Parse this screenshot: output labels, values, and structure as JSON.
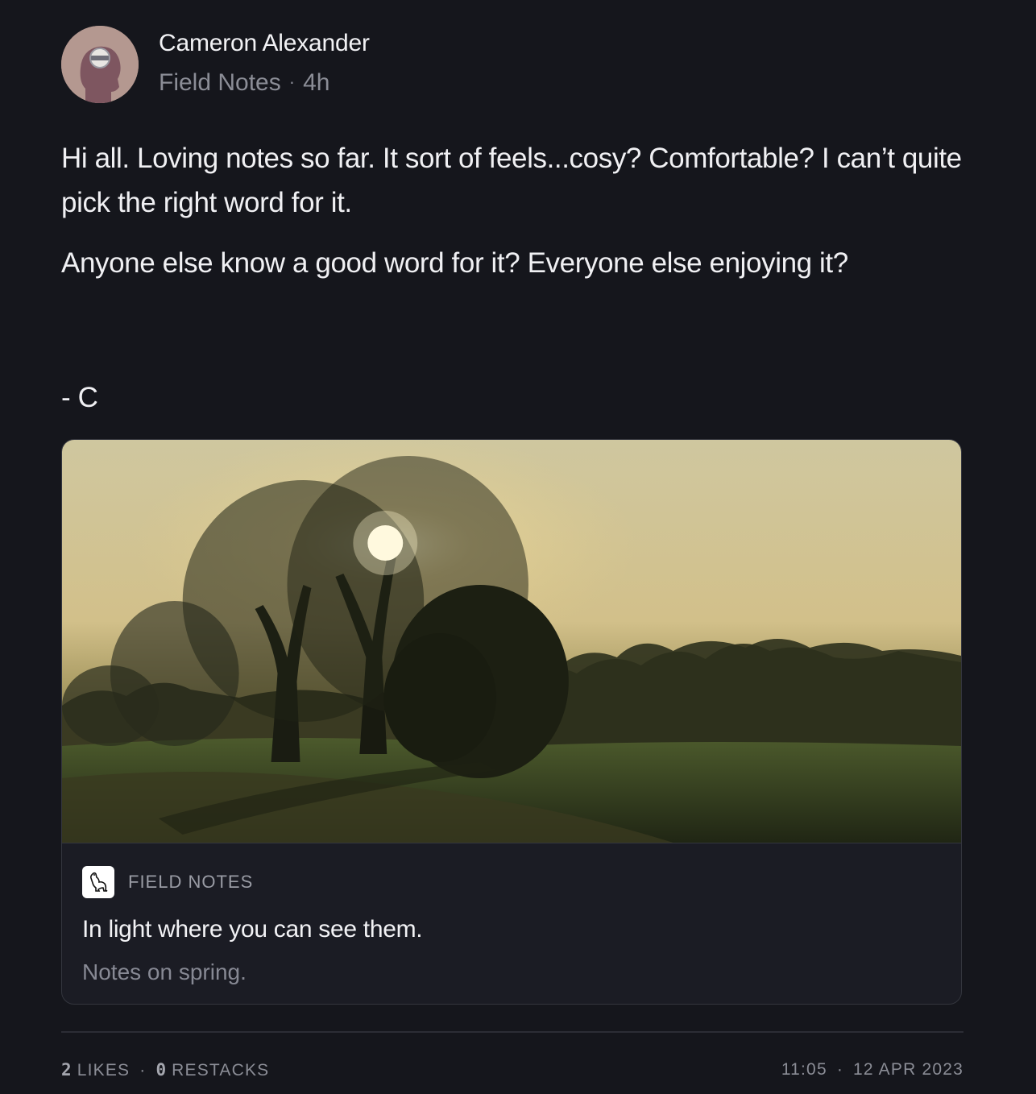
{
  "post": {
    "author": "Cameron Alexander",
    "publication": "Field Notes",
    "age": "4h",
    "body": {
      "p1": "Hi all. Loving notes so far. It sort of feels...cosy? Comfortable? I can’t quite pick the right word for it.",
      "p2": "Anyone else know a good word for it? Everyone else enjoying it?",
      "sign": "- C"
    },
    "card": {
      "publication": "FIELD NOTES",
      "title": "In light where you can see them.",
      "subtitle": "Notes on spring."
    },
    "footer": {
      "likes_count": "2",
      "likes_label": "LIKES",
      "restacks_count": "0",
      "restacks_label": "RESTACKS",
      "time": "11:05",
      "date": "12 APR 2023"
    }
  },
  "separator": "·",
  "icons": {
    "avatar": "profile-avatar",
    "publication_logo": "greyhound-logo-icon"
  }
}
